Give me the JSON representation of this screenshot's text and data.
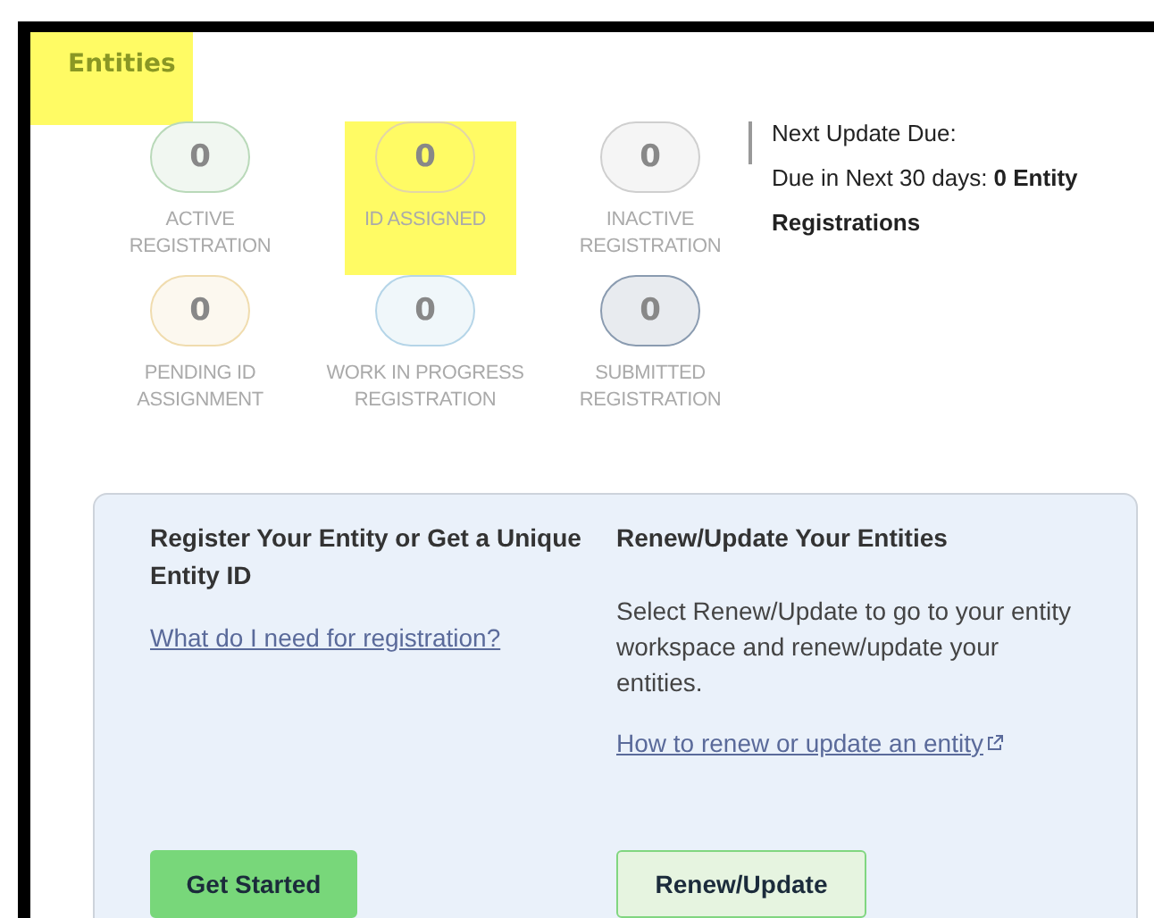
{
  "section": {
    "title": "Entities",
    "title_highlighted": true
  },
  "stats": [
    {
      "count": "0",
      "label": "ACTIVE REGISTRATION",
      "color": "#b9d9b9",
      "highlighted": false
    },
    {
      "count": "0",
      "label": "ID ASSIGNED",
      "color": "#e3d6a6",
      "highlighted": true
    },
    {
      "count": "0",
      "label": "INACTIVE REGISTRATION",
      "color": "#cfcfcf",
      "highlighted": false
    },
    {
      "count": "0",
      "label": "PENDING ID ASSIGNMENT",
      "color": "#f0dcae",
      "highlighted": false
    },
    {
      "count": "0",
      "label": "WORK IN PROGRESS REGISTRATION",
      "color": "#b5d5e8",
      "highlighted": false
    },
    {
      "count": "0",
      "label": "SUBMITTED REGISTRATION",
      "color": "#8a9bb0",
      "highlighted": false
    }
  ],
  "next_update": {
    "heading": "Next Update Due:",
    "text": "Due in Next 30 days: **0 Entity Registrations**"
  },
  "card": {
    "columns": [
      {
        "heading": "Register Your Entity or Get a Unique Entity ID",
        "link": "What do I need for registration?",
        "button": "Get Started",
        "kind": "primary"
      },
      {
        "heading": "Renew/Update Your Entities",
        "text": "Select Renew/Update to go to your entity workspace and renew/update your entities.",
        "link": "How to renew or update an entity",
        "external": true,
        "button": "Renew/Update",
        "kind": "secondary"
      }
    ]
  }
}
